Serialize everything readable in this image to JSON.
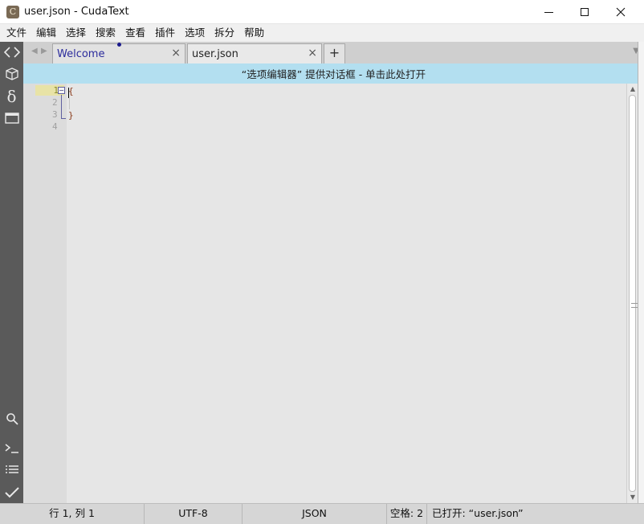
{
  "window": {
    "icon_letter": "C",
    "title": "user.json - CudaText",
    "minimize_icon": "minimize-icon",
    "maximize_icon": "maximize-icon",
    "close_icon": "close-icon"
  },
  "menu": [
    "文件",
    "编辑",
    "选择",
    "搜索",
    "查看",
    "插件",
    "选项",
    "拆分",
    "帮助"
  ],
  "sidebar": {
    "top_icons": [
      "code-tree-icon",
      "project-icon",
      "delta-icon",
      "panel-icon"
    ],
    "bottom_icons": [
      "search-icon",
      "console-icon",
      "list-icon",
      "check-icon"
    ]
  },
  "tabs": [
    {
      "label": "Welcome",
      "close": "×"
    },
    {
      "label": "user.json",
      "close": "×"
    }
  ],
  "tab_add": "+",
  "infobar": {
    "text": "“选项编辑器” 提供对话框 - 单击此处打开"
  },
  "editor": {
    "line_numbers": [
      "1",
      "2",
      "3",
      "4"
    ],
    "lines": [
      "{",
      "",
      "}",
      ""
    ],
    "fold_marker": "−"
  },
  "statusbar": {
    "position": "行 1, 列 1",
    "encoding": "UTF-8",
    "lexer": "JSON",
    "tab_size": "空格: 2",
    "message": "已打开: “user.json”"
  },
  "colors": {
    "sidebar": "#5a5a5a",
    "infobar": "#b3dff0",
    "editor_bg": "#e6e6e6",
    "current_line_number": "#e8e3a6"
  }
}
